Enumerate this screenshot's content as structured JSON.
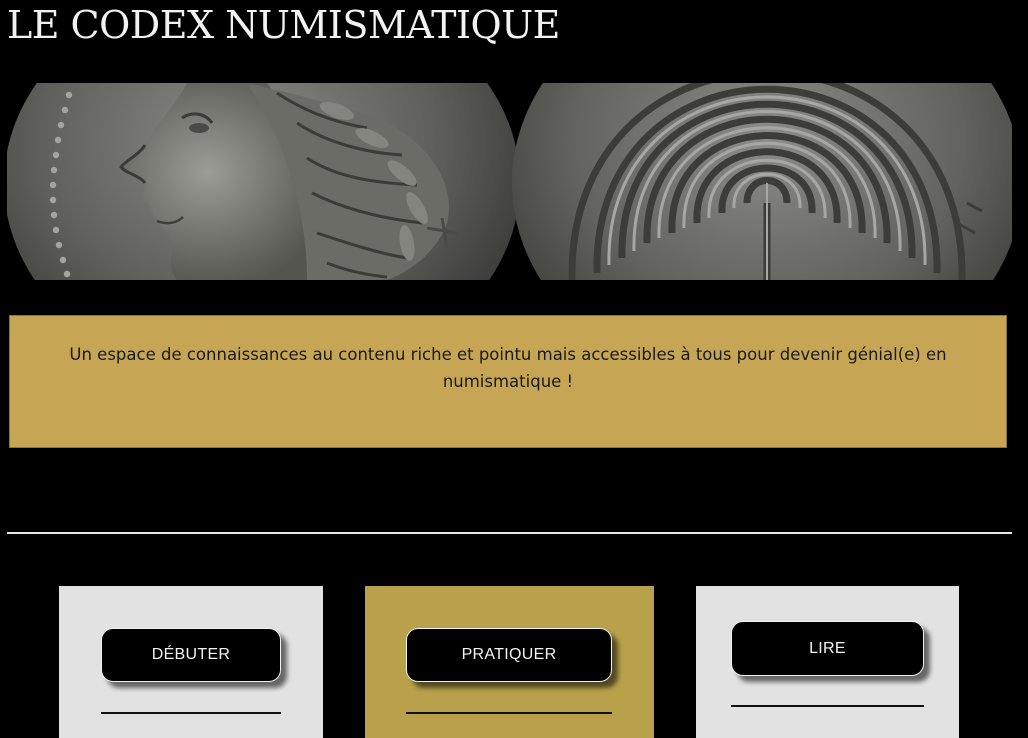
{
  "header": {
    "site_title": "LE CODEX NUMISMATIQUE"
  },
  "banner": {
    "obverse": "coin-obverse-laureate-head",
    "reverse": "coin-reverse-labyrinth"
  },
  "intro": {
    "tagline": "Un espace de connaissances au contenu riche et pointu mais accessibles à tous pour devenir génial(e) en numismatique !"
  },
  "cards": [
    {
      "label": "DÉBUTER"
    },
    {
      "label": "PRATIQUER"
    },
    {
      "label": "LIRE"
    }
  ],
  "colors": {
    "background": "#000000",
    "tagline_box": "#c6a655",
    "card_light": "#e2e2e2",
    "card_gold": "#b8a14a",
    "button": "#000000"
  }
}
